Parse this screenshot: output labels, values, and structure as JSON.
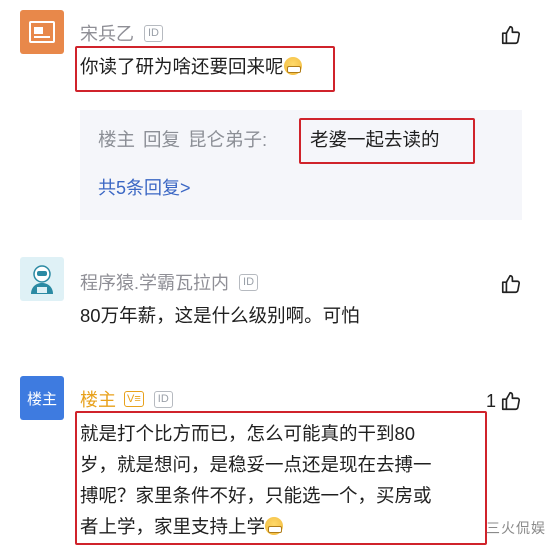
{
  "comments": [
    {
      "username": "宋兵乙",
      "id_badge": "ID",
      "text": "你读了研为啥还要回来呢",
      "avatar_icon": "news-icon",
      "reply": {
        "prefix": "楼主",
        "verb": "回复",
        "target": "昆仑弟子:",
        "content": "老婆一起去读的",
        "count_label": "共5条回复>"
      }
    },
    {
      "username": "程序猿.学霸瓦拉内",
      "id_badge": "ID",
      "text": "80万年薪，这是什么级别啊。可怕",
      "avatar_icon": "robot-avatar-icon"
    },
    {
      "username": "楼主",
      "avatar_label": "楼主",
      "id_badge": "ID",
      "host_badge": "V≡",
      "like_count": "1",
      "text_lines": [
        "就是打个比方而已，怎么可能真的干到80",
        "岁，就是想问，是稳妥一点还是现在去搏一",
        "搏呢？家里条件不好，只能选一个，买房或",
        "者上学，家里支持上学"
      ]
    }
  ],
  "watermark": "三火侃娱",
  "colors": {
    "highlight_box": "#d0232b",
    "link": "#3b67c4",
    "host": "#e8a11b"
  }
}
